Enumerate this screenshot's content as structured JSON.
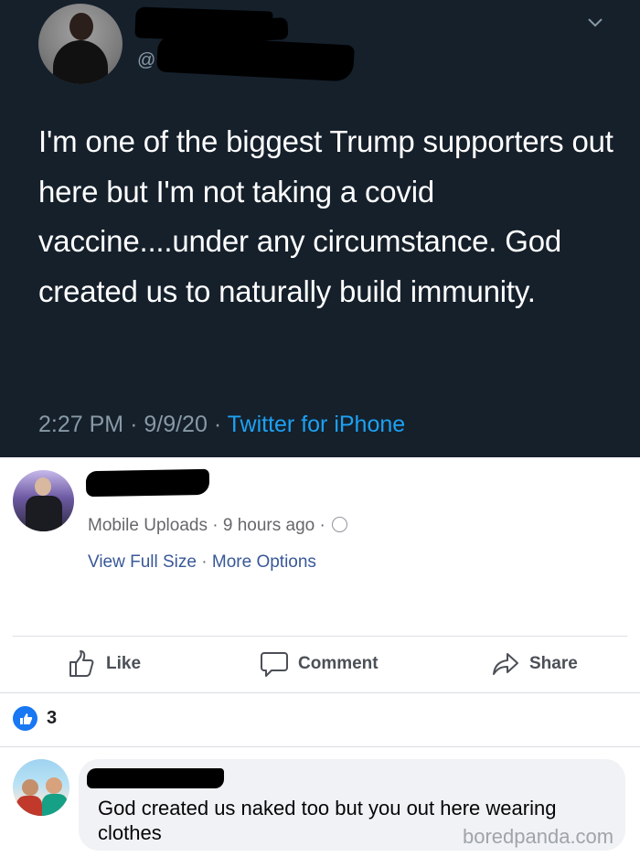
{
  "tweet": {
    "handle_prefix": "@",
    "text": "I'm one of the biggest Trump supporters out here but I'm not taking a covid vaccine....under any circumstance. God created us to naturally build immunity.",
    "time": "2:27 PM",
    "date": "9/9/20",
    "source": "Twitter for iPhone",
    "separator": "·",
    "background": "#15202b",
    "source_color": "#1da1f2"
  },
  "post": {
    "album": "Mobile Uploads",
    "time_ago": "9 hours ago",
    "view_full_size": "View Full Size",
    "more_options": "More Options",
    "separator": "·",
    "actions": {
      "like": "Like",
      "comment": "Comment",
      "share": "Share"
    },
    "reaction_count": "3",
    "accent": "#1877f2"
  },
  "comment": {
    "text": "God created us naked too but you out here wearing clothes"
  },
  "watermark": "boredpanda.com"
}
